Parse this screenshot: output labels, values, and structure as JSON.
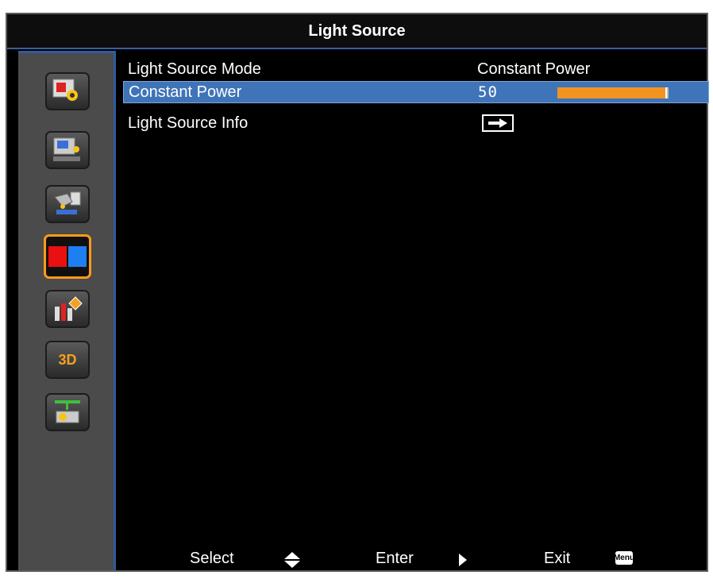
{
  "header": {
    "title": "Light Source"
  },
  "sidebar": {
    "items": [
      {
        "icon": "image-settings-icon"
      },
      {
        "icon": "display-settings-icon"
      },
      {
        "icon": "setup-icon"
      },
      {
        "icon": "light-source-icon",
        "active": true
      },
      {
        "icon": "information-icon"
      },
      {
        "icon": "3d-icon",
        "label": "3D"
      },
      {
        "icon": "network-icon"
      }
    ]
  },
  "menu": {
    "rows": [
      {
        "label": "Light Source Mode",
        "value": "Constant Power"
      },
      {
        "label": "Constant Power",
        "value": "50",
        "level_percent": 50,
        "selected": true
      },
      {
        "label": "Light Source Info",
        "icon": "enter-arrow-icon"
      }
    ]
  },
  "footer": {
    "select_label": "Select",
    "enter_label": "Enter",
    "exit_label": "Exit",
    "menu_key": "Menu"
  },
  "colors": {
    "highlight": "#3f74b8",
    "accent": "#f29421",
    "active_border": "#ff9a1a"
  }
}
